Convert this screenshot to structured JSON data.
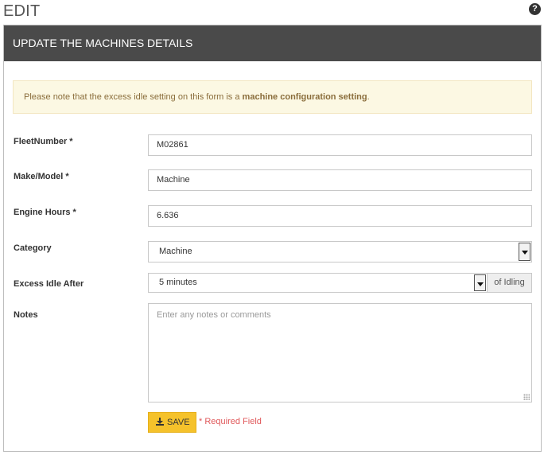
{
  "page": {
    "title": "EDIT",
    "help_icon": "question-circle-icon",
    "help_glyph": "?"
  },
  "panel": {
    "header": "UPDATE THE MACHINES DETAILS",
    "notice": {
      "prefix": "Please note that the excess idle setting on this form is a ",
      "emphasis": "machine configuration setting",
      "suffix": "."
    }
  },
  "form": {
    "fleet_number": {
      "label": "FleetNumber *",
      "value": "M02861"
    },
    "make_model": {
      "label": "Make/Model *",
      "value": "Machine"
    },
    "engine_hours": {
      "label": "Engine Hours *",
      "value": "6.636"
    },
    "category": {
      "label": "Category",
      "selected": "Machine"
    },
    "excess_idle": {
      "label": "Excess Idle After",
      "selected": "5 minutes",
      "addon": "of Idling"
    },
    "notes": {
      "label": "Notes",
      "placeholder": "Enter any notes or comments"
    }
  },
  "actions": {
    "save_label": "SAVE",
    "save_icon": "download-icon",
    "required_note": "* Required Field"
  },
  "colors": {
    "header_bg": "#4a4a4a",
    "notice_bg": "#fcf8e3",
    "notice_text": "#8a6d3b",
    "save_button": "#f5c22b",
    "required_text": "#e0585a"
  }
}
